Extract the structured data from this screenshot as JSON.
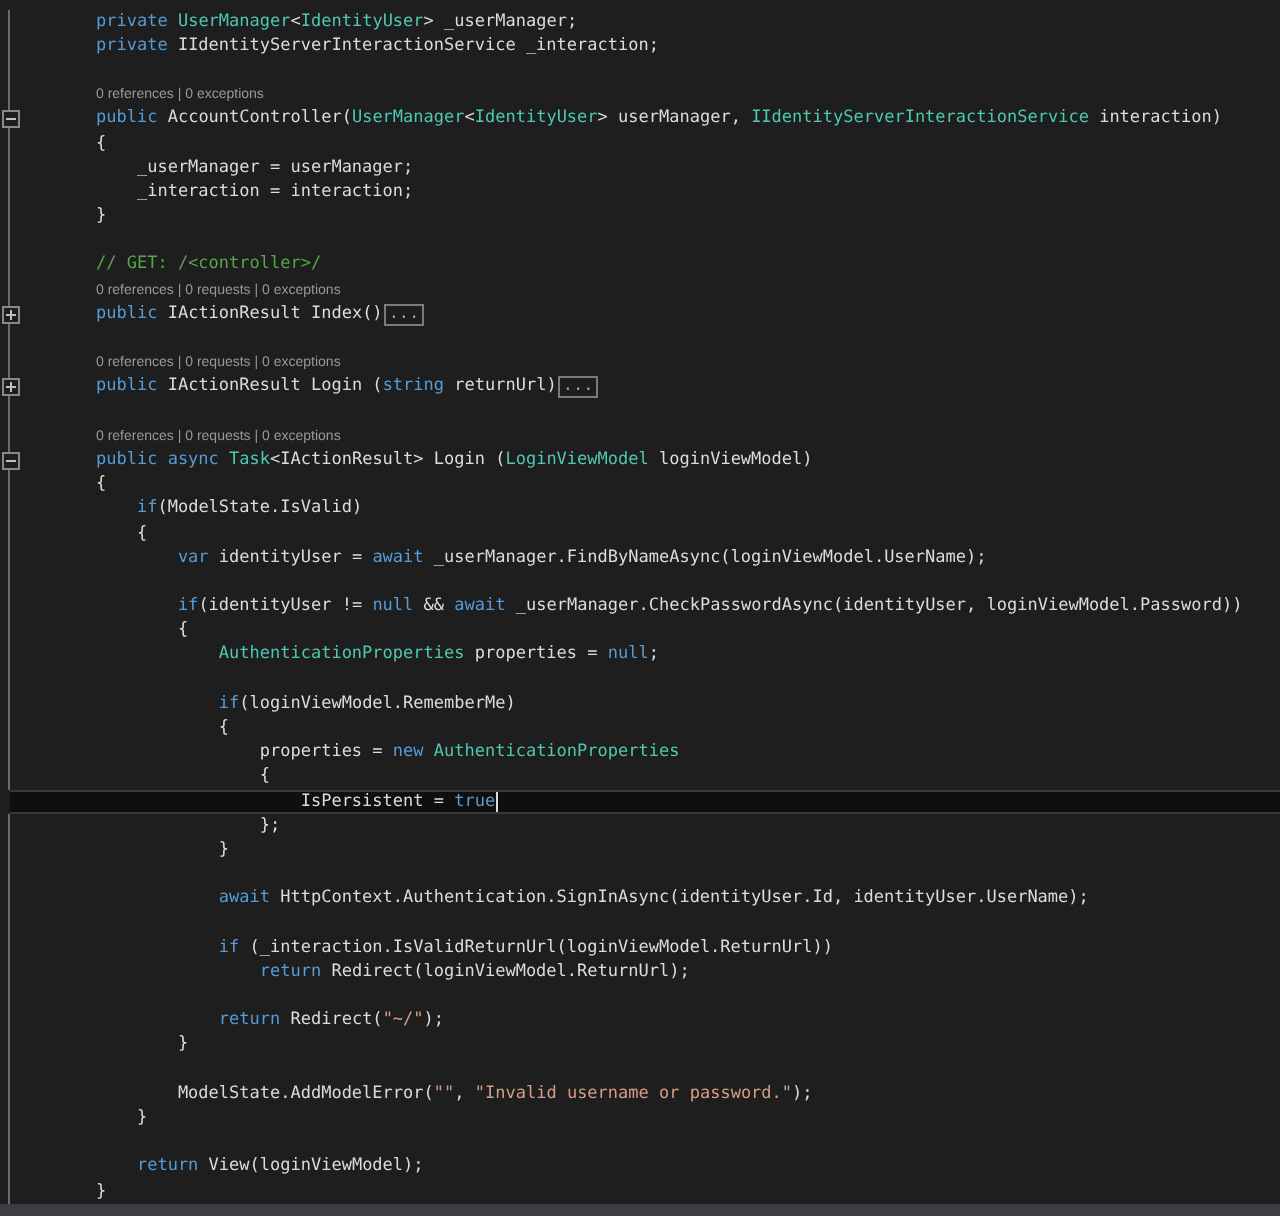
{
  "lines": [
    {
      "kind": "code",
      "current": false,
      "tokens": [
        {
          "kind": "keyword",
          "text": "private "
        },
        {
          "kind": "type",
          "text": "UserManager"
        },
        {
          "kind": "plain",
          "text": "<"
        },
        {
          "kind": "type",
          "text": "IdentityUser"
        },
        {
          "kind": "plain",
          "text": "> _userManager;"
        }
      ]
    },
    {
      "kind": "code",
      "current": false,
      "tokens": [
        {
          "kind": "keyword",
          "text": "private"
        },
        {
          "kind": "plain",
          "text": " IIdentityServerInteractionService _interaction;"
        }
      ]
    },
    {
      "kind": "blank"
    },
    {
      "kind": "lens",
      "text": "0 references | 0 exceptions"
    },
    {
      "kind": "code",
      "current": false,
      "collapsed": false,
      "tokens": [
        {
          "kind": "keyword",
          "text": "public"
        },
        {
          "kind": "plain",
          "text": " AccountController("
        },
        {
          "kind": "type",
          "text": "UserManager"
        },
        {
          "kind": "plain",
          "text": "<"
        },
        {
          "kind": "type",
          "text": "IdentityUser"
        },
        {
          "kind": "plain",
          "text": "> userManager, "
        },
        {
          "kind": "type",
          "text": "IIdentityServerInteractionService"
        },
        {
          "kind": "plain",
          "text": " interaction)"
        }
      ]
    },
    {
      "kind": "code",
      "current": false,
      "tokens": [
        {
          "kind": "plain",
          "text": "{"
        }
      ]
    },
    {
      "kind": "code",
      "current": false,
      "tokens": [
        {
          "kind": "plain",
          "text": "    _userManager = userManager;"
        }
      ]
    },
    {
      "kind": "code",
      "current": false,
      "tokens": [
        {
          "kind": "plain",
          "text": "    _interaction = interaction;"
        }
      ]
    },
    {
      "kind": "code",
      "current": false,
      "tokens": [
        {
          "kind": "plain",
          "text": "}"
        }
      ]
    },
    {
      "kind": "blank"
    },
    {
      "kind": "code",
      "current": false,
      "tokens": [
        {
          "kind": "comment",
          "text": "// GET: /<controller>/"
        }
      ]
    },
    {
      "kind": "lens",
      "text": "0 references | 0 requests | 0 exceptions"
    },
    {
      "kind": "code",
      "current": false,
      "collapsed": true,
      "hint": "...",
      "tokens": [
        {
          "kind": "keyword",
          "text": "public"
        },
        {
          "kind": "plain",
          "text": " IActionResult Index()"
        }
      ]
    },
    {
      "kind": "blank"
    },
    {
      "kind": "lens",
      "text": "0 references | 0 requests | 0 exceptions"
    },
    {
      "kind": "code",
      "current": false,
      "collapsed": true,
      "hint": "...",
      "tokens": [
        {
          "kind": "keyword",
          "text": "public"
        },
        {
          "kind": "plain",
          "text": " IActionResult Login ("
        },
        {
          "kind": "keyword",
          "text": "string"
        },
        {
          "kind": "plain",
          "text": " returnUrl)"
        }
      ]
    },
    {
      "kind": "blank"
    },
    {
      "kind": "lens",
      "text": "0 references | 0 requests | 0 exceptions"
    },
    {
      "kind": "code",
      "current": false,
      "collapsed": false,
      "tokens": [
        {
          "kind": "keyword",
          "text": "public async "
        },
        {
          "kind": "type",
          "text": "Task"
        },
        {
          "kind": "plain",
          "text": "<IActionResult> Login ("
        },
        {
          "kind": "type",
          "text": "LoginViewModel"
        },
        {
          "kind": "plain",
          "text": " loginViewModel)"
        }
      ]
    },
    {
      "kind": "code",
      "current": false,
      "tokens": [
        {
          "kind": "plain",
          "text": "{"
        }
      ]
    },
    {
      "kind": "code",
      "current": false,
      "tokens": [
        {
          "kind": "keyword",
          "text": "    if"
        },
        {
          "kind": "plain",
          "text": "(ModelState.IsValid)"
        }
      ]
    },
    {
      "kind": "code",
      "current": false,
      "tokens": [
        {
          "kind": "plain",
          "text": "    {"
        }
      ]
    },
    {
      "kind": "code",
      "current": false,
      "tokens": [
        {
          "kind": "keyword",
          "text": "        var"
        },
        {
          "kind": "plain",
          "text": " identityUser = "
        },
        {
          "kind": "keyword",
          "text": "await"
        },
        {
          "kind": "plain",
          "text": " _userManager.FindByNameAsync(loginViewModel.UserName);"
        }
      ]
    },
    {
      "kind": "blank"
    },
    {
      "kind": "code",
      "current": false,
      "tokens": [
        {
          "kind": "keyword",
          "text": "        if"
        },
        {
          "kind": "plain",
          "text": "(identityUser != "
        },
        {
          "kind": "keyword",
          "text": "null"
        },
        {
          "kind": "plain",
          "text": " && "
        },
        {
          "kind": "keyword",
          "text": "await"
        },
        {
          "kind": "plain",
          "text": " _userManager.CheckPasswordAsync(identityUser, loginViewModel.Password))"
        }
      ]
    },
    {
      "kind": "code",
      "current": false,
      "tokens": [
        {
          "kind": "plain",
          "text": "        {"
        }
      ]
    },
    {
      "kind": "code",
      "current": false,
      "tokens": [
        {
          "kind": "type",
          "text": "            AuthenticationProperties"
        },
        {
          "kind": "plain",
          "text": " properties = "
        },
        {
          "kind": "keyword",
          "text": "null"
        },
        {
          "kind": "plain",
          "text": ";"
        }
      ]
    },
    {
      "kind": "blank"
    },
    {
      "kind": "code",
      "current": false,
      "tokens": [
        {
          "kind": "keyword",
          "text": "            if"
        },
        {
          "kind": "plain",
          "text": "(loginViewModel.RememberMe)"
        }
      ]
    },
    {
      "kind": "code",
      "current": false,
      "tokens": [
        {
          "kind": "plain",
          "text": "            {"
        }
      ]
    },
    {
      "kind": "code",
      "current": false,
      "tokens": [
        {
          "kind": "plain",
          "text": "                properties = "
        },
        {
          "kind": "keyword",
          "text": "new "
        },
        {
          "kind": "type",
          "text": "AuthenticationProperties"
        }
      ]
    },
    {
      "kind": "code",
      "current": false,
      "tokens": [
        {
          "kind": "plain",
          "text": "                {"
        }
      ]
    },
    {
      "kind": "code",
      "current": true,
      "tokens": [
        {
          "kind": "plain",
          "text": "                    IsPersistent = "
        },
        {
          "kind": "keyword",
          "text": "true"
        }
      ]
    },
    {
      "kind": "code",
      "current": false,
      "tokens": [
        {
          "kind": "plain",
          "text": "                };"
        }
      ]
    },
    {
      "kind": "code",
      "current": false,
      "tokens": [
        {
          "kind": "plain",
          "text": "            }"
        }
      ]
    },
    {
      "kind": "blank"
    },
    {
      "kind": "code",
      "current": false,
      "tokens": [
        {
          "kind": "keyword",
          "text": "            await"
        },
        {
          "kind": "plain",
          "text": " HttpContext.Authentication.SignInAsync(identityUser.Id, identityUser.UserName);"
        }
      ]
    },
    {
      "kind": "blank"
    },
    {
      "kind": "code",
      "current": false,
      "tokens": [
        {
          "kind": "keyword",
          "text": "            if"
        },
        {
          "kind": "plain",
          "text": " (_interaction.IsValidReturnUrl(loginViewModel.ReturnUrl))"
        }
      ]
    },
    {
      "kind": "code",
      "current": false,
      "tokens": [
        {
          "kind": "keyword",
          "text": "                return"
        },
        {
          "kind": "plain",
          "text": " Redirect(loginViewModel.ReturnUrl);"
        }
      ]
    },
    {
      "kind": "blank"
    },
    {
      "kind": "code",
      "current": false,
      "tokens": [
        {
          "kind": "keyword",
          "text": "            return"
        },
        {
          "kind": "plain",
          "text": " Redirect("
        },
        {
          "kind": "string",
          "text": "\"~/\""
        },
        {
          "kind": "plain",
          "text": ");"
        }
      ]
    },
    {
      "kind": "code",
      "current": false,
      "tokens": [
        {
          "kind": "plain",
          "text": "        }"
        }
      ]
    },
    {
      "kind": "blank"
    },
    {
      "kind": "code",
      "current": false,
      "tokens": [
        {
          "kind": "plain",
          "text": "        ModelState.AddModelError("
        },
        {
          "kind": "string",
          "text": "\"\""
        },
        {
          "kind": "plain",
          "text": ", "
        },
        {
          "kind": "string",
          "text": "\"Invalid username or password.\""
        },
        {
          "kind": "plain",
          "text": ");"
        }
      ]
    },
    {
      "kind": "code",
      "current": false,
      "tokens": [
        {
          "kind": "plain",
          "text": "    }"
        }
      ]
    },
    {
      "kind": "blank"
    },
    {
      "kind": "code",
      "current": false,
      "tokens": [
        {
          "kind": "keyword",
          "text": "    return"
        },
        {
          "kind": "plain",
          "text": " View(loginViewModel);"
        }
      ]
    },
    {
      "kind": "code",
      "current": false,
      "tokens": [
        {
          "kind": "plain",
          "text": "}"
        }
      ]
    }
  ]
}
